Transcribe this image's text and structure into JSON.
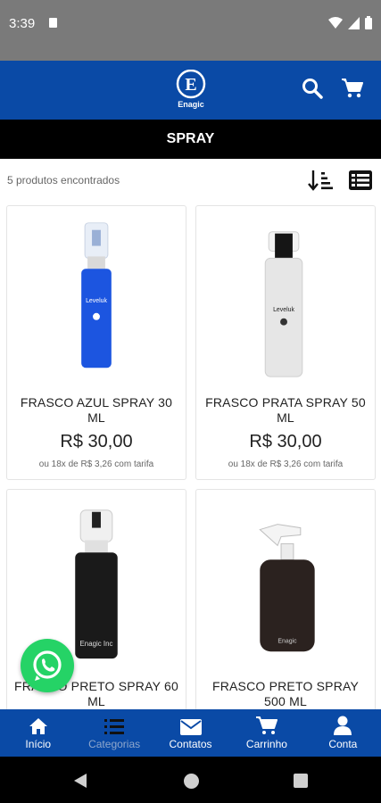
{
  "status_bar": {
    "time": "3:39"
  },
  "header": {
    "logo_text": "Enagic",
    "logo_letter": "E"
  },
  "page": {
    "title": "SPRAY"
  },
  "results": {
    "count_text": "5 produtos encontrados"
  },
  "products": [
    {
      "name": "FRASCO AZUL SPRAY 30 ML",
      "price": "R$ 30,00",
      "installments": "ou 18x de R$ 3,26 com tarifa",
      "bottle_color": "#1c55e0",
      "bottle_label": "Leveluk"
    },
    {
      "name": "FRASCO PRATA SPRAY 50 ML",
      "price": "R$ 30,00",
      "installments": "ou 18x de R$ 3,26 com tarifa",
      "bottle_color": "#e6e6e6",
      "bottle_label": "Leveluk"
    },
    {
      "name": "FRASCO PRETO SPRAY 60 ML",
      "price": "",
      "installments": "",
      "bottle_color": "#1a1a1a",
      "bottle_label": "Enagic Inc"
    },
    {
      "name": "FRASCO PRETO SPRAY 500 ML",
      "price": "",
      "installments": "",
      "bottle_color": "#2b221f",
      "bottle_label": "Enagic"
    }
  ],
  "bottom_nav": [
    {
      "label": "Início",
      "icon": "home-icon",
      "active": false
    },
    {
      "label": "Categorias",
      "icon": "list-icon",
      "active": true
    },
    {
      "label": "Contatos",
      "icon": "mail-icon",
      "active": false
    },
    {
      "label": "Carrinho",
      "icon": "cart-icon",
      "active": false
    },
    {
      "label": "Conta",
      "icon": "user-icon",
      "active": false
    }
  ]
}
